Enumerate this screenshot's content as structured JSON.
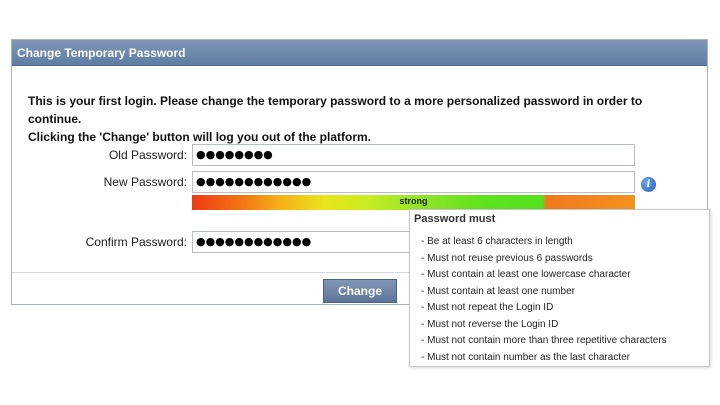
{
  "dialog": {
    "title": "Change Temporary Password",
    "intro_line1": "This is your first login. Please change the temporary password to a more personalized password in order to continue.",
    "intro_line2": "Clicking the 'Change' button will log you out of the platform."
  },
  "form": {
    "old_password": {
      "label": "Old Password:",
      "value": "●●●●●●●●"
    },
    "new_password": {
      "label": "New Password:",
      "value": "●●●●●●●●●●●●"
    },
    "confirm_password": {
      "label": "Confirm Password:",
      "value": "●●●●●●●●●●●●"
    },
    "strength": {
      "label": "strong"
    },
    "info_icon": "info-icon",
    "change_label": "Change"
  },
  "tooltip": {
    "title": "Password must",
    "rules": [
      "- Be at least 6 characters in length",
      "- Must not reuse previous 6 passwords",
      "- Must contain at least one lowercase character",
      "- Must contain at least one number",
      "- Must not repeat the Login ID",
      "- Must not reverse the Login ID",
      "- Must not contain more than three repetitive characters",
      "- Must not contain number as the last character"
    ]
  },
  "colors": {
    "titlebar": "#6f8aad",
    "button": "#6a82a8",
    "strength_strong": "#5ee21f"
  }
}
